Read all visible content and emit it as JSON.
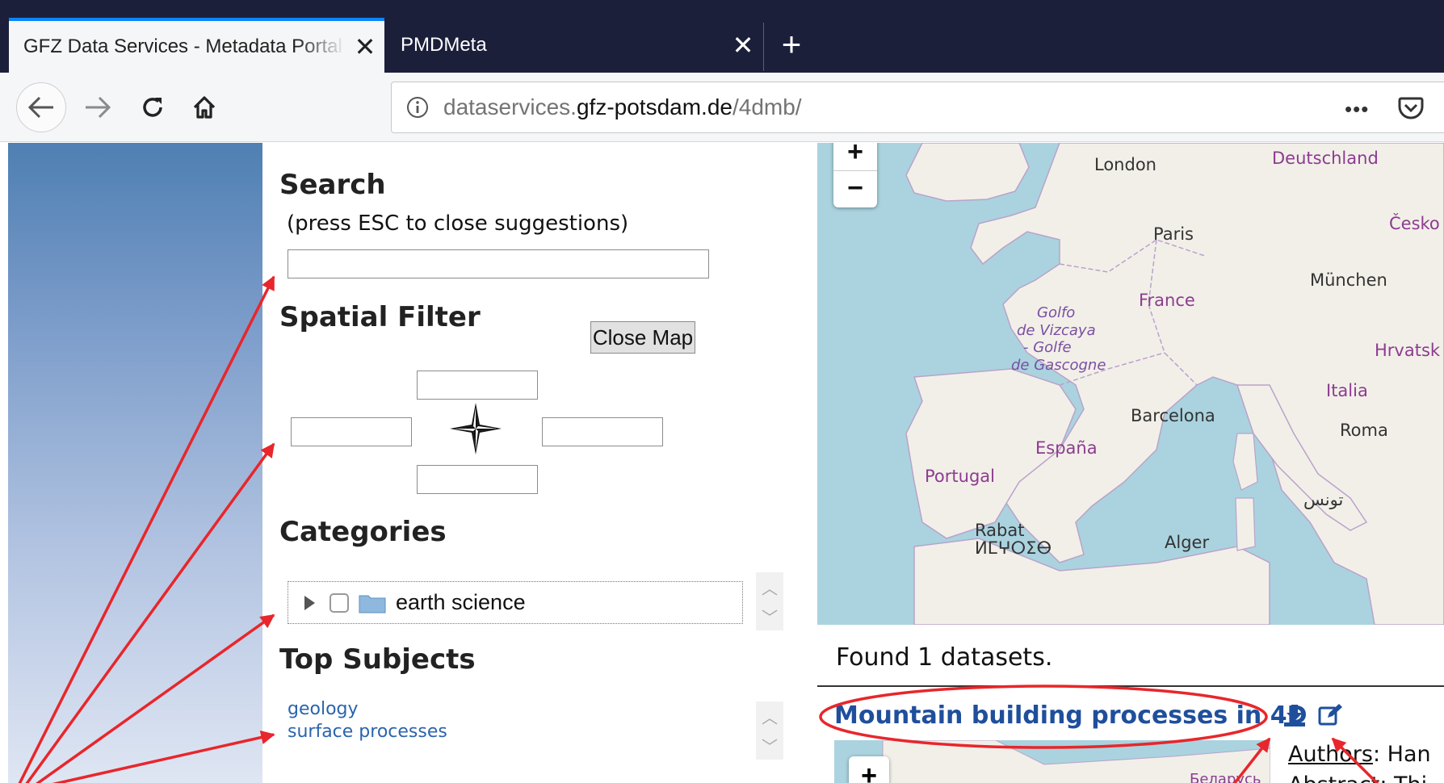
{
  "browser": {
    "tabs": [
      {
        "title": "GFZ Data Services - Metadata Portal",
        "close": "✕"
      },
      {
        "title": "PMDMeta",
        "close": "✕"
      }
    ],
    "new_tab": "+",
    "url": {
      "prefix": "dataservices.",
      "domain": "gfz-potsdam.de",
      "path": "/4dmb/"
    },
    "more": "•••"
  },
  "search": {
    "heading": "Search",
    "hint": "(press ESC to close suggestions)",
    "value": ""
  },
  "spatial_filter": {
    "heading": "Spatial Filter",
    "close_map_label": "Close Map",
    "north": "",
    "south": "",
    "east": "",
    "west": ""
  },
  "categories": {
    "heading": "Categories",
    "items": [
      {
        "label": "earth science",
        "checked": false
      }
    ]
  },
  "top_subjects": {
    "heading": "Top Subjects",
    "items": [
      "geology",
      "surface processes"
    ]
  },
  "map": {
    "zoom_in": "+",
    "zoom_out": "−",
    "labels": {
      "london": "London",
      "deutschland": "Deutschland",
      "cesko": "Česko",
      "paris": "Paris",
      "munchen": "München",
      "france": "France",
      "golfo": "Golfo",
      "vizcaya": "de Vizcaya",
      "golfe": "- Golfe",
      "gascogne": "de Gascogne",
      "hrvatska": "Hrvatsk",
      "italia": "Italia",
      "roma": "Roma",
      "barcelona": "Barcelona",
      "espana": "España",
      "portugal": "Portugal",
      "rabat": "Rabat",
      "amazigh": "ⵍⵎⵖⵔⵉⴱ",
      "alger": "Alger",
      "tunis": "تونس"
    },
    "colors": {
      "sea": "#aad3df",
      "land": "#f2efe9",
      "border": "#b9a3c9"
    }
  },
  "results": {
    "found_text": "Found 1 datasets.",
    "dataset_title": "Mountain building processes in 4D",
    "mini_map_zoom": "+",
    "mini_map_label": "Беларусь",
    "authors_label": "Authors",
    "authors_value": ": Han",
    "abstract_text": "Abstract: Thi"
  },
  "icons": {
    "download": "download-icon",
    "edit": "edit-icon",
    "annotation_color": "#e8262b"
  }
}
